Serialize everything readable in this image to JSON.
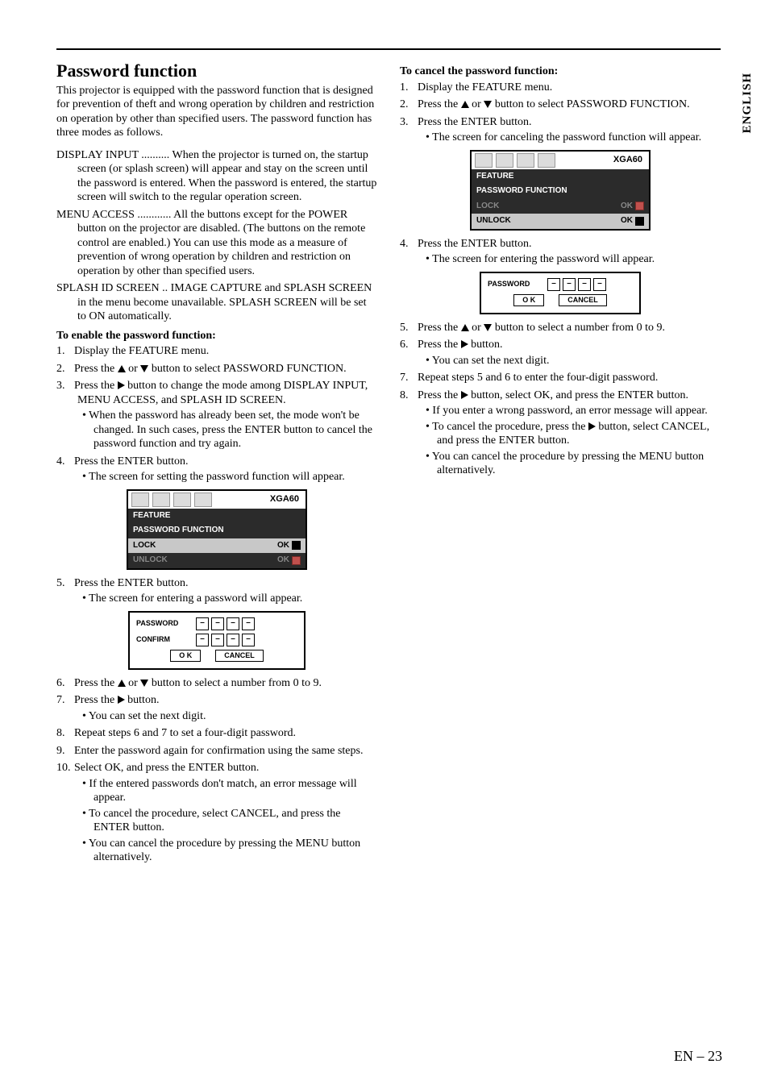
{
  "side_label": "ENGLISH",
  "heading": "Password function",
  "intro": "This projector is equipped with the password function that is designed for prevention of theft and wrong operation by children and restriction on operation by other than specified users. The password function has three modes as follows.",
  "modes": {
    "display_input_label": "DISPLAY INPUT ..........",
    "display_input_text": " When the projector is turned on, the startup screen (or splash screen) will appear and stay on the screen until the password is entered. When the password is entered, the startup screen will switch to the regular operation screen.",
    "menu_access_label": "MENU ACCESS ............",
    "menu_access_text": " All the buttons except for the POWER button on the projector are disabled. (The buttons on the remote control are enabled.) You can use this mode as a measure of prevention of wrong operation by children and restriction on operation by other than specified users.",
    "splash_id_label": "SPLASH ID SCREEN ..",
    "splash_id_text": " IMAGE CAPTURE and SPLASH SCREEN in the menu become unavailable. SPLASH SCREEN will be set to ON automatically."
  },
  "enable": {
    "title": "To enable the password function:",
    "steps": [
      "Display the FEATURE menu.",
      "Press the ▲ or ▼ button to select PASSWORD FUNCTION.",
      "Press the ▶ button to change the mode among DISPLAY INPUT, MENU ACCESS, and SPLASH ID SCREEN.",
      "Press the ENTER button.",
      "Press the ENTER button.",
      "Press the ▲ or ▼ button to select a number from 0 to 9.",
      "Press the ▶ button.",
      "Repeat steps 6 and 7 to set a four-digit password.",
      "Enter the password again for confirmation using the same steps.",
      "Select OK, and press the ENTER button."
    ],
    "bullets_step3": [
      "When the password has already been set, the mode won't be changed. In such cases, press the ENTER button to cancel the password function and try again."
    ],
    "bullets_step4": [
      "The screen for setting the password function will appear."
    ],
    "bullets_step5": [
      "The screen for entering a password will appear."
    ],
    "bullets_step7": [
      "You can set the next digit."
    ],
    "bullets_step10": [
      "If the entered passwords don't match, an error message will appear.",
      "To cancel the procedure, select CANCEL, and press the ENTER button.",
      "You can cancel the procedure by pressing the MENU button alternatively."
    ]
  },
  "cancel": {
    "title": "To cancel the password function:",
    "steps": [
      "Display the FEATURE menu.",
      "Press the ▲ or ▼ button to select PASSWORD FUNCTION.",
      "Press the ENTER button.",
      "Press the ENTER button.",
      "Press the ▲ or ▼ button to select a number from 0 to 9.",
      "Press the ▶ button.",
      "Repeat steps 5 and 6 to enter the four-digit password.",
      "Press the ▶ button, select OK, and press the ENTER button."
    ],
    "bullets_step3": [
      "The screen for canceling the password function will appear."
    ],
    "bullets_step4": [
      "The screen for entering the password will appear."
    ],
    "bullets_step6": [
      "You can set the next digit."
    ],
    "bullets_step8": [
      "If you enter a wrong password, an error message will appear.",
      "To cancel the procedure, press the ▶ button, select CANCEL, and press the ENTER button.",
      "You can cancel the procedure by pressing the MENU button alternatively."
    ]
  },
  "osd": {
    "res": "XGA60",
    "feature": "FEATURE",
    "pw_function": "PASSWORD FUNCTION",
    "lock": "LOCK",
    "unlock": "UNLOCK",
    "ok": "OK"
  },
  "pwd": {
    "password": "PASSWORD",
    "confirm": "CONFIRM",
    "ok_btn": "O K",
    "cancel_btn": "CANCEL",
    "dash": "–"
  },
  "page_number": "EN – 23"
}
